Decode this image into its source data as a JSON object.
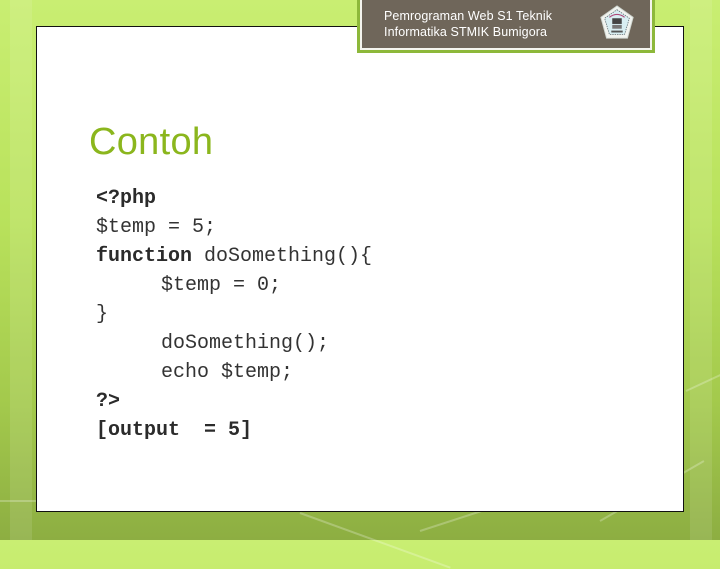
{
  "header": {
    "line1": "Pemrograman Web S1 Teknik",
    "line2": "Informatika STMIK Bumigora",
    "logo_icon": "institution-emblem-icon"
  },
  "slide": {
    "title": "Contoh",
    "code": {
      "php_open": "<?php",
      "assign_outer": "$temp = 5;",
      "function_kw": "function",
      "function_sig": " doSomething(){",
      "assign_inner": "$temp = 0;",
      "close_brace": "}",
      "call": "doSomething();",
      "echo": "echo $temp;",
      "php_close": "?>",
      "output": "[output  = 5]"
    }
  },
  "colors": {
    "accent_green": "#8bb61d",
    "header_bg": "#6f665a"
  }
}
